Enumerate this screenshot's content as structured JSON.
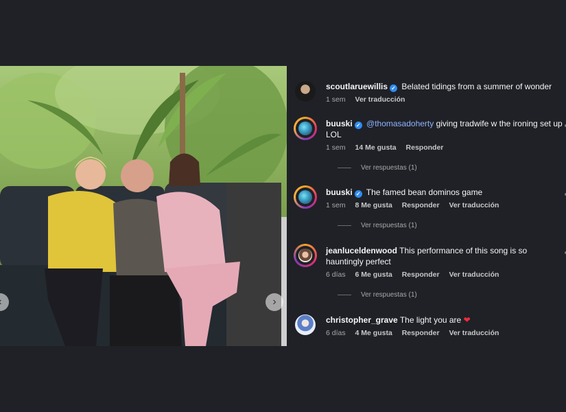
{
  "photo": {
    "alt_icon_left": "‹",
    "alt_icon_right": "›"
  },
  "comments": [
    {
      "user": "scoutlaruewillis",
      "verified": true,
      "text": "Belated tidings from a summer of wonder",
      "time": "1 sem",
      "likes": "",
      "reply_label": "",
      "translate_label": "Ver traducción"
    },
    {
      "user": "buuski",
      "verified": true,
      "mention": "@thomasadoherty",
      "text": " giving tradwife w the ironing set up LOL",
      "time": "1 sem",
      "likes": "14 Me gusta",
      "reply_label": "Responder",
      "view_replies": "Ver respuestas (1)"
    },
    {
      "user": "buuski",
      "verified": true,
      "text": "The famed bean dominos game",
      "time": "1 sem",
      "likes": "8 Me gusta",
      "reply_label": "Responder",
      "translate_label": "Ver traducción",
      "view_replies": "Ver respuestas (1)"
    },
    {
      "user": "jeanluceldenwood",
      "verified": false,
      "text": "This performance of this song is so hauntingly perfect",
      "time": "6 días",
      "likes": "6 Me gusta",
      "reply_label": "Responder",
      "translate_label": "Ver traducción",
      "view_replies": "Ver respuestas (1)"
    },
    {
      "user": "christopher_grave",
      "verified": false,
      "text": "The light you are ",
      "emoji": "❤",
      "time": "6 días",
      "likes": "4 Me gusta",
      "reply_label": "Responder",
      "translate_label": "Ver traducción"
    }
  ],
  "colors": {
    "verified": "#2f8cf0",
    "mention": "#8fb3ff",
    "heart": "#ed2d3b",
    "background": "#1f2127"
  }
}
